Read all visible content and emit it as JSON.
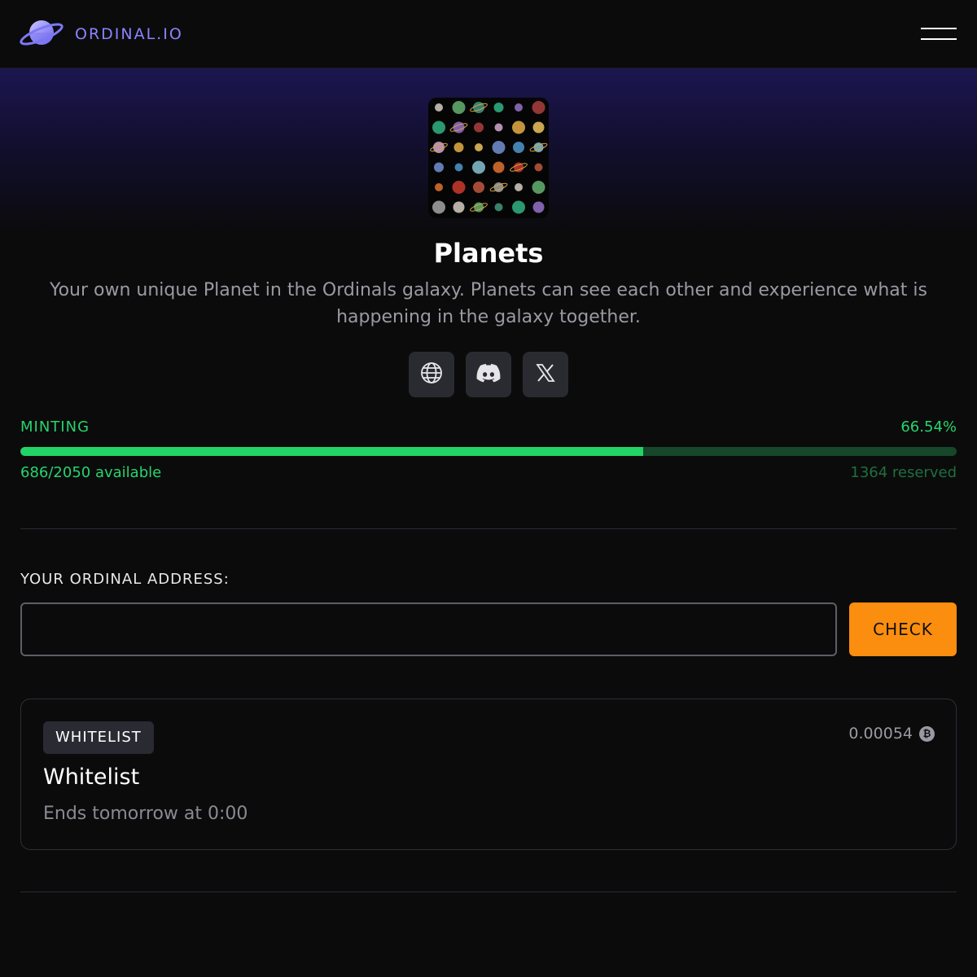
{
  "nav": {
    "brand": "ORDINAL.IO",
    "logo_icon": "planet-logo-icon",
    "menu_icon": "hamburger-menu-icon"
  },
  "collection": {
    "image_icon": "planets-collection-grid",
    "title": "Planets",
    "description": "Your own unique Planet in the Ordinals galaxy. Planets can see each other and experience what is happening in the galaxy together.",
    "socials": [
      {
        "icon": "globe-icon"
      },
      {
        "icon": "discord-icon"
      },
      {
        "icon": "x-icon"
      }
    ]
  },
  "mint": {
    "status": "MINTING",
    "percent_label": "66.54%",
    "progress_fraction": 0.6654,
    "available_label": "686/2050 available",
    "reserved_label": "1364 reserved"
  },
  "address": {
    "label": "YOUR ORDINAL ADDRESS:",
    "value": "",
    "button": "CHECK"
  },
  "phase": {
    "badge": "WHITELIST",
    "price": "0.00054",
    "currency_icon": "bitcoin-icon",
    "name": "Whitelist",
    "ends": "Ends tomorrow at 0:00"
  },
  "colors": {
    "accent_brand": "#8a84ff",
    "minting_green": "#27d46b",
    "check_orange": "#fb8d0f",
    "background": "#0b0b0c"
  }
}
